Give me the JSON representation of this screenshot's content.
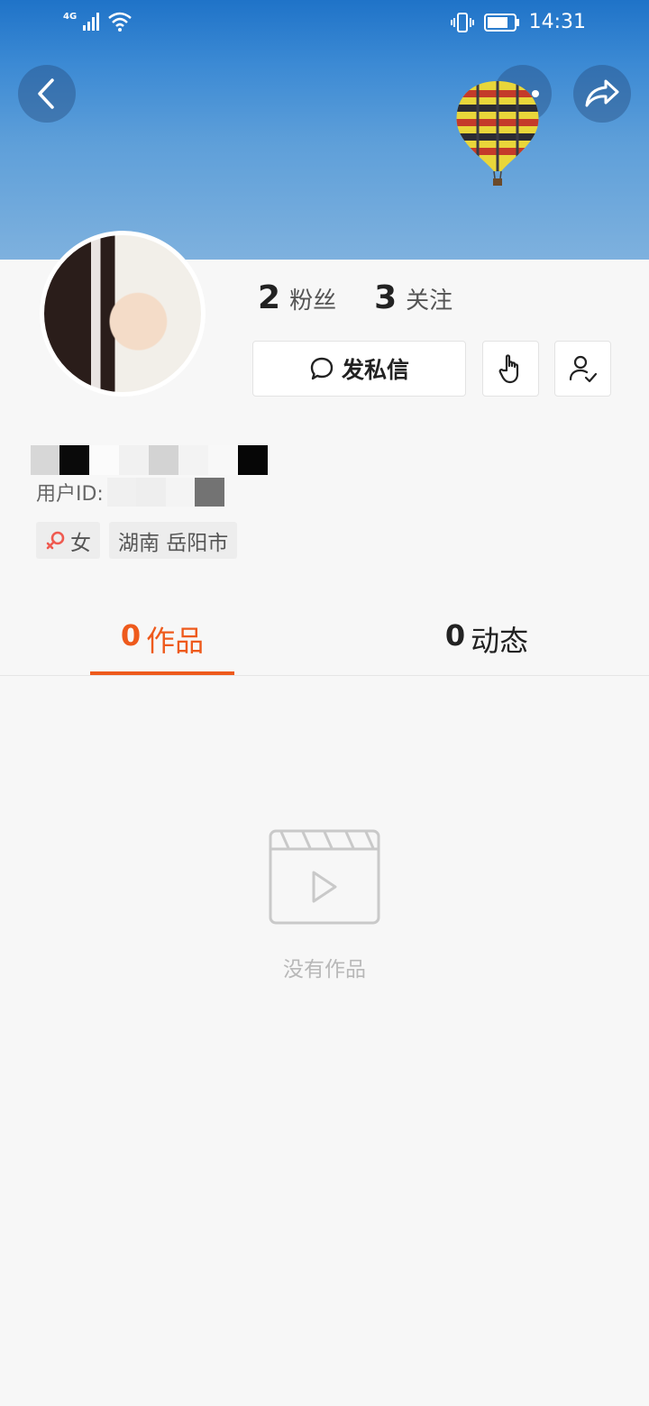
{
  "status_bar": {
    "network": "4G",
    "time": "14:31"
  },
  "profile": {
    "followers_count": "2",
    "followers_label": "粉丝",
    "following_count": "3",
    "following_label": "关注",
    "message_button": "发私信",
    "user_id_label": "用户ID:",
    "gender": "女",
    "location": "湖南 岳阳市"
  },
  "tabs": [
    {
      "count": "0",
      "label": "作品",
      "active": true
    },
    {
      "count": "0",
      "label": "动态",
      "active": false
    }
  ],
  "empty_state": {
    "text": "没有作品"
  },
  "colors": {
    "accent": "#ee5a1c",
    "background": "#f7f7f7"
  }
}
